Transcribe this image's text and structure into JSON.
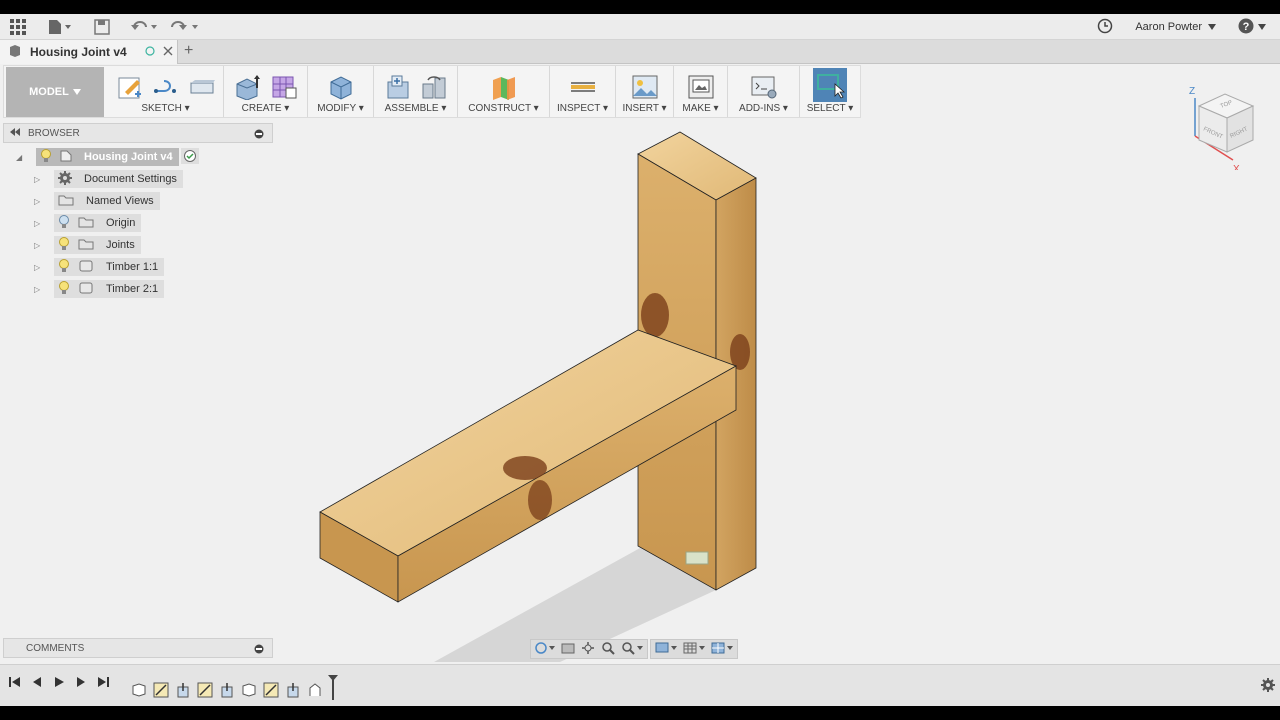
{
  "user": {
    "name": "Aaron Powter"
  },
  "document": {
    "title": "Housing Joint v4"
  },
  "toolbar": {
    "workspace": "MODEL",
    "groups": {
      "sketch": "SKETCH",
      "create": "CREATE",
      "modify": "MODIFY",
      "assemble": "ASSEMBLE",
      "construct": "CONSTRUCT",
      "inspect": "INSPECT",
      "insert": "INSERT",
      "make": "MAKE",
      "addins": "ADD-INS",
      "select": "SELECT"
    }
  },
  "browser": {
    "title": "BROWSER",
    "root": "Housing Joint v4",
    "items": [
      {
        "label": "Document Settings",
        "icon": "gear-icon"
      },
      {
        "label": "Named Views",
        "icon": "folder-icon"
      },
      {
        "label": "Origin",
        "icon": "folder-icon"
      },
      {
        "label": "Joints",
        "icon": "folder-icon"
      },
      {
        "label": "Timber 1:1",
        "icon": "component-icon"
      },
      {
        "label": "Timber 2:1",
        "icon": "component-icon"
      }
    ]
  },
  "comments": {
    "title": "COMMENTS"
  },
  "viewcube": {
    "top": "TOP",
    "front": "FRONT",
    "right": "RIGHT",
    "axis_z": "Z",
    "axis_x": "X"
  },
  "colors": {
    "accent": "#4a88c7",
    "wood": "#d9b273",
    "wood_dark": "#b88a4c",
    "panel": "#f0f0f0"
  }
}
